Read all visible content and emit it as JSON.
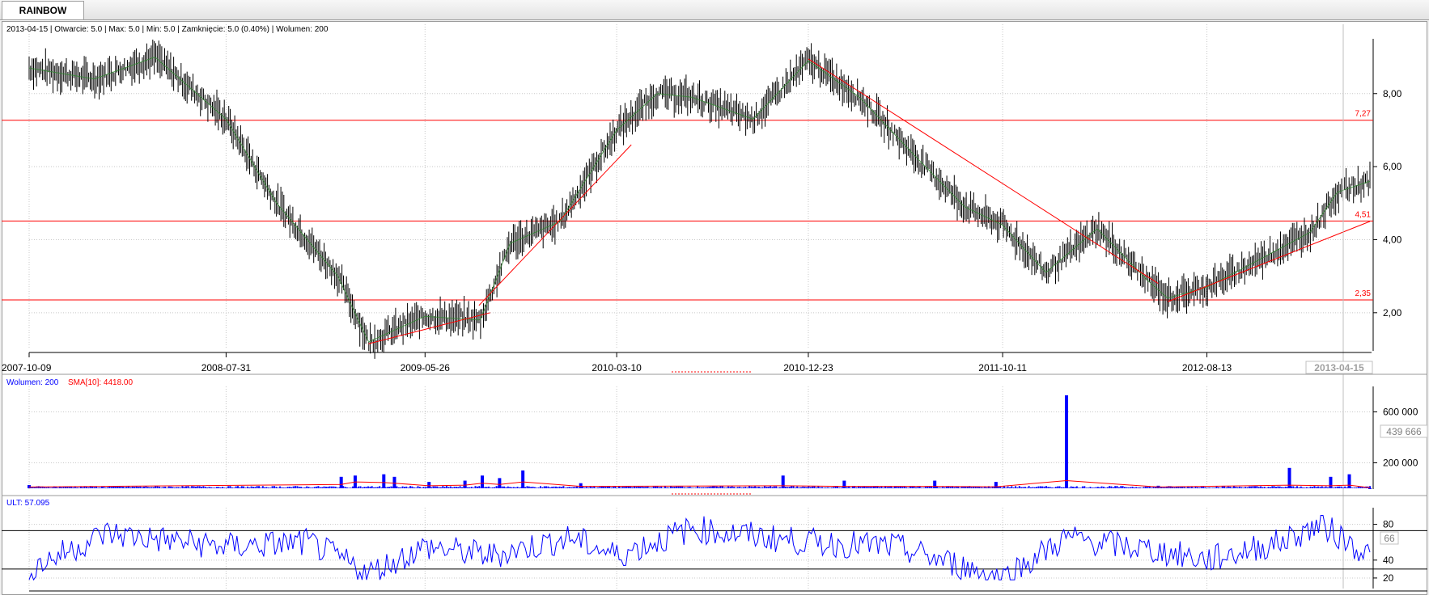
{
  "tab": {
    "label": "RAINBOW"
  },
  "price_panel": {
    "info": "2013-04-15 | Otwarcie: 5.0 | Max: 5.0 | Min: 5.0 | Zamknięcie: 5.0 (0.40%)  | Wolumen: 200",
    "y_ticks": [
      "8,00",
      "6,00",
      "4,00",
      "2,00"
    ],
    "h_lines": [
      {
        "label": "7,27",
        "value": 7.27
      },
      {
        "label": "4,51",
        "value": 4.51
      },
      {
        "label": "2,35",
        "value": 2.35
      }
    ],
    "date_ticks": [
      "2007-10-09",
      "2008-07-31",
      "2009-05-26",
      "2010-03-10",
      "2010-12-23",
      "2011-10-11",
      "2012-08-13"
    ],
    "last_date": "2013-04-15"
  },
  "volume_panel": {
    "legend_volume": "Wolumen: 200",
    "legend_sma": "SMA[10]: 4418.00",
    "y_ticks": [
      "600 000",
      "200 000"
    ],
    "marker": "439 666"
  },
  "ult_panel": {
    "legend": "ULT: 57.095",
    "y_ticks": [
      "80",
      "40",
      "20"
    ],
    "marker": "66"
  },
  "colors": {
    "candles": "#000000",
    "trend": "#ff0000",
    "volume": "#0000ff",
    "sma": "#ff0000",
    "ult": "#0000ff",
    "grid": "#c8c8c8"
  },
  "chart_data": [
    {
      "type": "line",
      "title": "RAINBOW",
      "x": [
        "2007-10-09",
        "2008-01-15",
        "2008-04-15",
        "2008-07-31",
        "2008-10-15",
        "2009-01-15",
        "2009-03-02",
        "2009-05-26",
        "2009-08-17",
        "2009-10-01",
        "2009-12-15",
        "2010-03-10",
        "2010-05-10",
        "2010-07-01",
        "2010-10-01",
        "2010-12-23",
        "2011-03-10",
        "2011-06-01",
        "2011-08-15",
        "2011-10-11",
        "2011-12-15",
        "2012-03-01",
        "2012-05-15",
        "2012-06-15",
        "2012-08-13",
        "2012-10-15",
        "2013-01-15",
        "2013-02-25",
        "2013-04-15"
      ],
      "series": [
        {
          "values": [
            8.7,
            8.4,
            9.0,
            7.3,
            5.0,
            3.0,
            1.2,
            1.9,
            1.8,
            3.9,
            4.5,
            7.0,
            8.0,
            7.9,
            7.3,
            8.9,
            7.9,
            6.3,
            4.9,
            4.4,
            3.1,
            4.3,
            2.9,
            2.4,
            2.7,
            3.3,
            4.2,
            5.3,
            5.6
          ]
        }
      ],
      "ylim": [
        1.0,
        9.5
      ],
      "h_lines": [
        7.27,
        4.51,
        2.35
      ],
      "trendlines": [
        {
          "x1": "2009-03-02",
          "y1": 1.15,
          "x2": "2009-09-01",
          "y2": 2.0
        },
        {
          "x1": "2009-08-15",
          "y1": 2.2,
          "x2": "2010-04-01",
          "y2": 6.6
        },
        {
          "x1": "2010-12-23",
          "y1": 8.95,
          "x2": "2012-06-01",
          "y2": 2.8
        },
        {
          "x1": "2012-06-15",
          "y1": 2.3,
          "x2": "2013-04-15",
          "y2": 4.5
        }
      ]
    },
    {
      "type": "bar",
      "title": "Wolumen: 200",
      "x": [
        "2007-10-09",
        "2009-01-20",
        "2009-02-10",
        "2009-03-25",
        "2009-04-10",
        "2009-06-01",
        "2009-07-25",
        "2009-08-20",
        "2009-09-15",
        "2009-10-20",
        "2010-01-15",
        "2010-11-15",
        "2011-02-15",
        "2011-07-01",
        "2011-10-01",
        "2012-01-15",
        "2012-06-01",
        "2012-12-15",
        "2013-02-15",
        "2013-03-15",
        "2013-04-15"
      ],
      "series": [
        {
          "name": "Wolumen",
          "values": [
            25000,
            90000,
            100000,
            110000,
            90000,
            50000,
            60000,
            100000,
            80000,
            140000,
            40000,
            100000,
            60000,
            60000,
            50000,
            730000,
            20000,
            160000,
            90000,
            110000,
            200
          ]
        },
        {
          "name": "SMA[10]",
          "values": [
            10000,
            30000,
            50000,
            45000,
            40000,
            20000,
            25000,
            40000,
            30000,
            50000,
            15000,
            20000,
            15000,
            15000,
            12000,
            60000,
            10000,
            25000,
            20000,
            25000,
            4418
          ]
        }
      ],
      "ylim": [
        0,
        800000
      ]
    },
    {
      "type": "line",
      "title": "ULT: 57.095",
      "x": [
        "2007-10-09",
        "2008-02-01",
        "2008-07-31",
        "2008-12-01",
        "2009-03-02",
        "2009-05-26",
        "2009-09-01",
        "2010-01-01",
        "2010-03-10",
        "2010-07-01",
        "2010-12-23",
        "2011-05-01",
        "2011-10-11",
        "2012-01-15",
        "2012-06-01",
        "2012-08-13",
        "2012-12-01",
        "2013-02-01",
        "2013-04-15"
      ],
      "series": [
        {
          "name": "ULT",
          "values": [
            30,
            70,
            55,
            60,
            25,
            55,
            45,
            65,
            45,
            75,
            60,
            55,
            20,
            65,
            50,
            40,
            60,
            80,
            45
          ]
        }
      ],
      "ylim": [
        10,
        95
      ],
      "h_lines": [
        73,
        30
      ]
    }
  ]
}
